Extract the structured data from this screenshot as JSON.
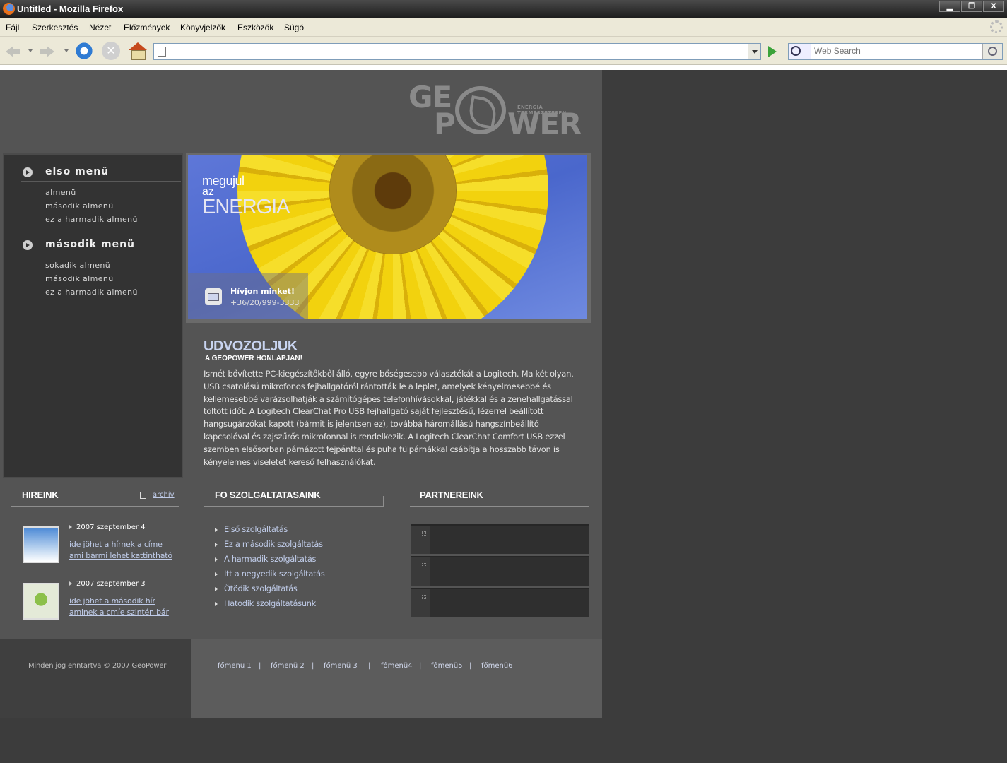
{
  "window": {
    "title": "Untitled - Mozilla Firefox",
    "buttons": [
      "▁",
      "❐",
      "X"
    ]
  },
  "menubar": [
    "Fájl",
    "Szerkesztés",
    "Nézet",
    "Előzmények",
    "Könyvjelzők",
    "Eszközök",
    "Súgó"
  ],
  "toolbar": {
    "stop_glyph": "✕",
    "url_value": "",
    "search_placeholder": "Web Search"
  },
  "logo": {
    "line1": "GE",
    "line2": "P",
    "line3": "WER",
    "tagline": "ENERGIA TERMÉSZETESEN"
  },
  "sidebar": {
    "menus": [
      {
        "title": "elso menü",
        "items": [
          "almenü",
          "második almenü",
          "ez a harmadik almenü"
        ]
      },
      {
        "title": "második menü",
        "items": [
          "sokadik almenü",
          "második almenü",
          "ez a harmadik almenü"
        ]
      }
    ]
  },
  "banner": {
    "line1": "megujul",
    "line2": "az",
    "line3": "ENERGIA",
    "contact_title": "Hívjon minket!",
    "contact_phone": "+36/20/999-3333"
  },
  "welcome": {
    "title": "UDVOZOLJUK",
    "subtitle": "A GEOPOWER HONLAPJAN!",
    "body": "Ismét bővítette PC-kiegészítőkből álló, egyre bőségesebb választékát a Logitech. Ma két olyan, USB csatolású mikrofonos fejhallgatóról rántották le a leplet, amelyek kényelmesebbé és kellemesebbé varázsolhatják a számítógépes telefonhívásokkal, játékkal és a zenehallgatással töltött időt. A Logitech ClearChat Pro USB fejhallgató saját fejlesztésű, lézerrel beállított hangsugárzókat kapott (bármit is jelentsen ez), továbbá háromállású hangszínbeállító kapcsolóval és zajszűrős mikrofonnal is rendelkezik. A Logitech ClearChat Comfort USB ezzel szemben elsősorban párnázott fejpánttal és puha fülpárnákkal csábítja a hosszabb távon is kényelemes viseletet kereső felhasználókat."
  },
  "news": {
    "title": "HIREINK",
    "archive_label": "archív",
    "items": [
      {
        "date": "2007 szeptember 4",
        "link_line1": "ide jöhet a hírnek a címe",
        "link_line2": "ami bármi lehet kattintható"
      },
      {
        "date": "2007 szeptember 3",
        "link_line1": "ide jöhet a második hír",
        "link_line2": "aminek a cmíe szintén bár"
      }
    ]
  },
  "services": {
    "title": "FO SZOLGALTATASAINK",
    "items": [
      "Első szolgáltatás",
      "Ez a második szolgáltatás",
      "A harmadik szolgáltatás",
      "Itt a negyedik szolgáltatás",
      "Ötödik szolgáltatás",
      "Hatodik szolgáltatásunk"
    ]
  },
  "partners": {
    "title": "PARTNEREINK"
  },
  "footer": {
    "copyright": "Minden jog enntartva  © 2007 GeoPower",
    "nav": [
      "főmenu 1",
      "|",
      "főmenü 2",
      "|",
      "főmenü 3",
      "|",
      "főmenü4",
      "|",
      "főmenü5",
      "|",
      "főmenü6"
    ]
  }
}
